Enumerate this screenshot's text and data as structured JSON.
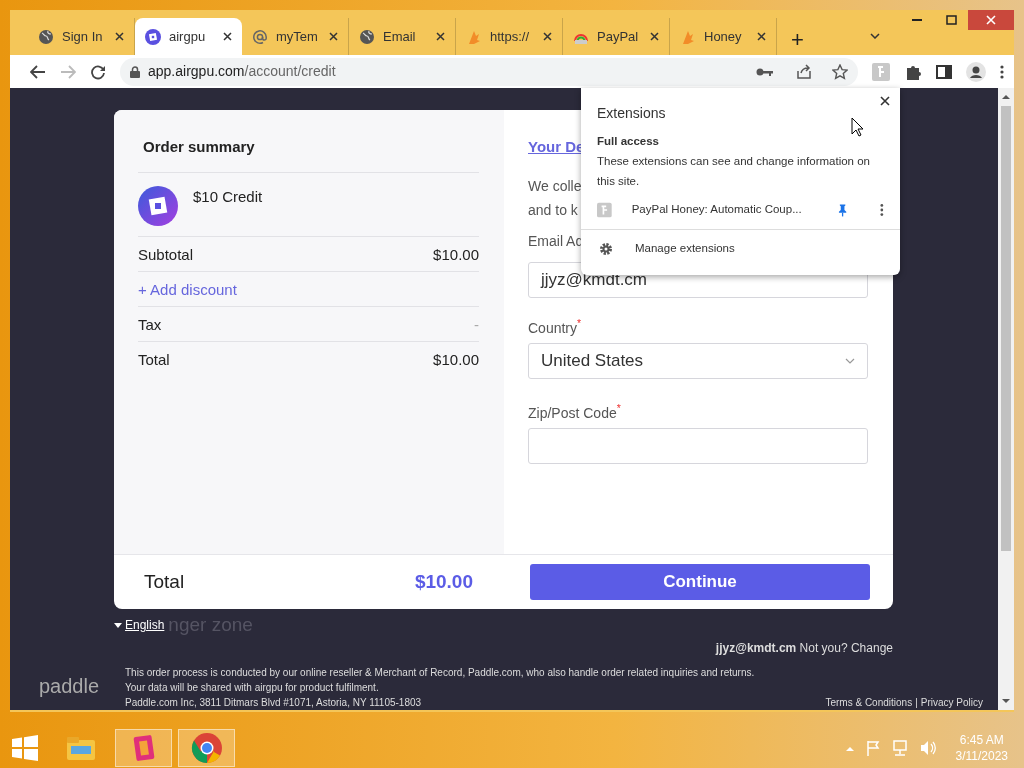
{
  "browser": {
    "tabs": [
      {
        "title": "Sign In",
        "kind": "globe",
        "selected": false
      },
      {
        "title": "airgpu",
        "kind": "logo",
        "selected": true
      },
      {
        "title": "myTem",
        "kind": "at",
        "selected": false
      },
      {
        "title": "Email",
        "kind": "globe",
        "selected": false
      },
      {
        "title": "https://",
        "kind": "honey",
        "selected": false
      },
      {
        "title": "PayPal",
        "kind": "paypal",
        "selected": false
      },
      {
        "title": "Honey",
        "kind": "honey",
        "selected": false
      }
    ],
    "new_tab": "+",
    "url_host": "app.airgpu.com",
    "url_path": "/account/credit"
  },
  "extensions_popup": {
    "title": "Extensions",
    "section": "Full access",
    "description": "These extensions can see and change information on this site.",
    "items": [
      {
        "name": "PayPal Honey: Automatic Coup...",
        "pinned": true
      }
    ],
    "manage": "Manage extensions"
  },
  "order_summary": {
    "title": "Order summary",
    "product": "$10 Credit",
    "rows": [
      {
        "kind": "line",
        "label": "Subtotal",
        "value": "$10.00"
      },
      {
        "kind": "link",
        "label": "+ Add discount"
      },
      {
        "kind": "line",
        "label": "Tax",
        "value": "-"
      },
      {
        "kind": "line",
        "label": "Total",
        "value": "$10.00"
      }
    ]
  },
  "details": {
    "heading": "Your De",
    "intro": [
      "We colle",
      "and to k"
    ],
    "fields": [
      {
        "kind": "input",
        "label": "Email Ad",
        "value": "jjyz@kmdt.cm"
      },
      {
        "kind": "select",
        "label": "Country",
        "mark": "*",
        "value": "United States"
      },
      {
        "kind": "input",
        "label": "Zip/Post Code",
        "mark": "*"
      }
    ]
  },
  "checkout_bar": {
    "label": "Total",
    "amount": "$10.00",
    "button": "Continue"
  },
  "footer": {
    "language": "English",
    "faded_heading": "nger zone",
    "account_email": "jjyz@kmdt.cm",
    "not_you": "Not you?",
    "change": "Change",
    "brand": "paddle",
    "notes": [
      "This order process is conducted by our online reseller & Merchant of Record, Paddle.com, who also handle order related inquiries and returns.",
      "Your data will be shared with airgpu for product fulfilment.",
      "Paddle.com Inc, 3811 Ditmars Blvd #1071, Astoria, NY 11105-1803"
    ],
    "links": [
      "Terms & Conditions",
      "Privacy Policy"
    ],
    "separator": "|"
  },
  "taskbar": {
    "apps": [
      {
        "kind": "explorer",
        "selected": false
      },
      {
        "kind": "app",
        "selected": true
      },
      {
        "kind": "chrome",
        "selected": true
      }
    ],
    "time": "6:45 AM",
    "date": "3/11/2023"
  }
}
